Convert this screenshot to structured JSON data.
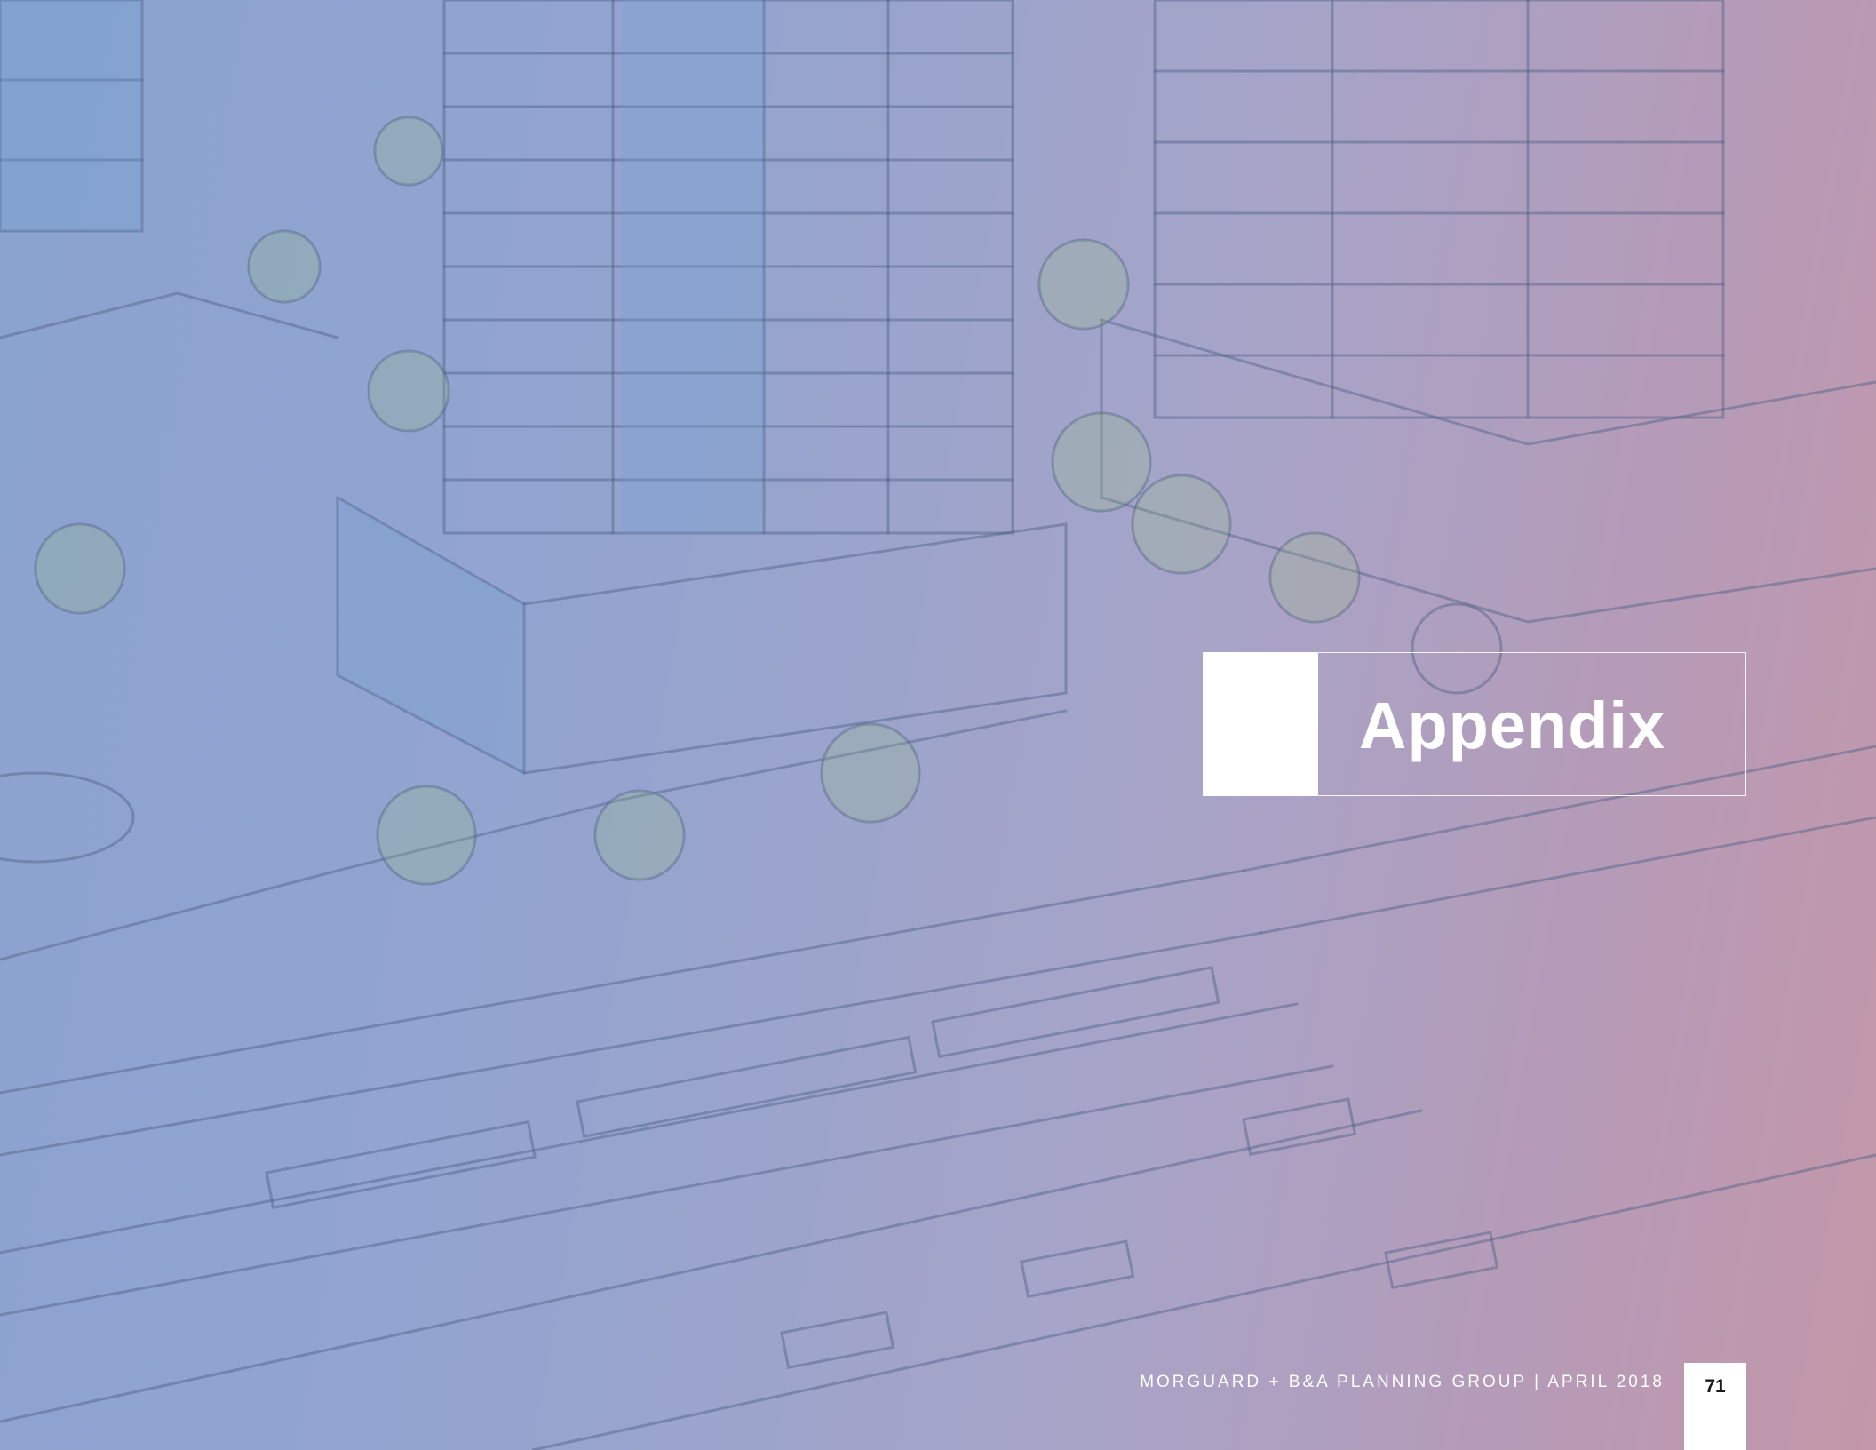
{
  "page": {
    "title": "Appendix",
    "footer": "MORGUARD + B&A PLANNING GROUP  |  APRIL 2018",
    "page_number": "71"
  },
  "illustration": {
    "subject": "architectural-sketch",
    "accent_colors": [
      "#8aa3cf",
      "#c497a9"
    ]
  }
}
